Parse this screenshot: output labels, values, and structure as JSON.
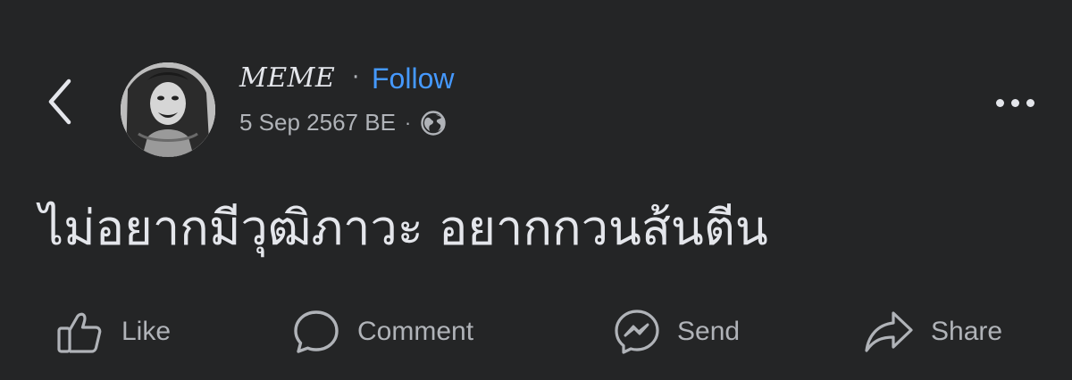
{
  "header": {
    "author_name": "MEME",
    "separator": "·",
    "follow_label": "Follow",
    "timestamp": "5 Sep 2567 BE",
    "meta_separator": "·",
    "privacy_icon": "globe-icon",
    "back_icon": "chevron-left-icon",
    "more_icon": "more-horizontal-icon"
  },
  "post": {
    "text": "ไม่อยากมีวุฒิภาวะ อยากกวนส้นตีน"
  },
  "actions": [
    {
      "label": "Like",
      "icon": "thumbs-up-icon"
    },
    {
      "label": "Comment",
      "icon": "comment-icon"
    },
    {
      "label": "Send",
      "icon": "messenger-icon"
    },
    {
      "label": "Share",
      "icon": "share-icon"
    }
  ],
  "colors": {
    "background": "#242526",
    "primary_text": "#e4e6eb",
    "secondary_text": "#b0b3b8",
    "link": "#4599ff"
  }
}
